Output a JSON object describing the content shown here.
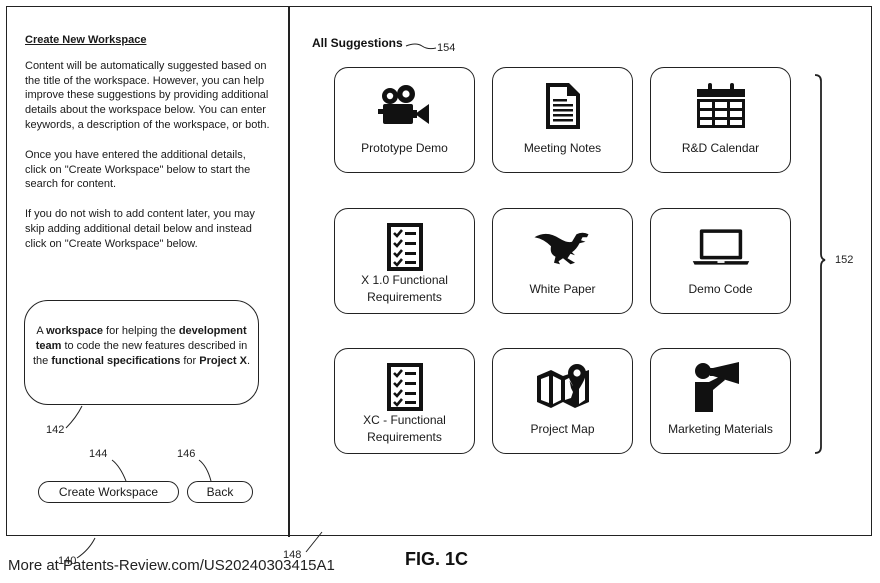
{
  "figure_label": "FIG. 1C",
  "watermark": "More at Patents-Review.com/US20240303415A1",
  "left_panel": {
    "title": "Create New Workspace",
    "paragraphs": [
      "Content will be automatically suggested based on the title of the workspace. However, you can help improve these suggestions by providing additional details about the workspace below.  You can enter keywords, a description of the workspace, or both.",
      "Once you have entered the additional details, click on \"Create Workspace\" below to start the search for content.",
      "If you do not wish to add content later, you may skip adding additional detail below and instead click on \"Create Workspace\" below."
    ],
    "description_input": {
      "segments": [
        {
          "text": "A ",
          "bold": false
        },
        {
          "text": "workspace",
          "bold": true
        },
        {
          "text": " for helping the ",
          "bold": false
        },
        {
          "text": "development team",
          "bold": true
        },
        {
          "text": " to code the new features described in the ",
          "bold": false
        },
        {
          "text": "functional specifications",
          "bold": true
        },
        {
          "text": " for ",
          "bold": false
        },
        {
          "text": "Project X",
          "bold": true
        },
        {
          "text": ".",
          "bold": false
        }
      ]
    },
    "buttons": {
      "create": "Create Workspace",
      "back": "Back"
    }
  },
  "right_panel": {
    "title": "All Suggestions",
    "cards": [
      {
        "label": "Prototype Demo",
        "icon": "movie-camera-icon"
      },
      {
        "label": "Meeting Notes",
        "icon": "document-icon"
      },
      {
        "label": "R&D Calendar",
        "icon": "calendar-icon"
      },
      {
        "label": "X 1.0 Functional Requirements",
        "icon": "checklist-icon"
      },
      {
        "label": "White Paper",
        "icon": "dinosaur-icon"
      },
      {
        "label": "Demo  Code",
        "icon": "laptop-icon"
      },
      {
        "label": "XC - Functional Requirements",
        "icon": "checklist-icon"
      },
      {
        "label": "Project Map",
        "icon": "map-pin-icon"
      },
      {
        "label": "Marketing Materials",
        "icon": "megaphone-person-icon"
      }
    ]
  },
  "reference_numerals": {
    "bubble": "142",
    "create_button": "144",
    "back_button": "146",
    "right_panel": "148",
    "left_panel": "140",
    "card_group": "152",
    "section_title": "154"
  }
}
